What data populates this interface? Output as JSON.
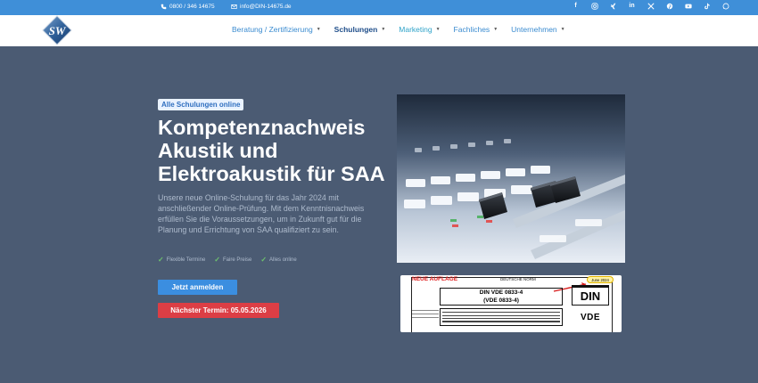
{
  "topbar": {
    "phone": "0800 / 346 14675",
    "email": "info@DIN-14675.de",
    "socials": [
      "facebook-icon",
      "instagram-icon",
      "xing-icon",
      "linkedin-icon",
      "x-icon",
      "pinterest-icon",
      "youtube-icon",
      "tiktok-icon",
      "whatsapp-icon"
    ],
    "color": "#3f8fd8"
  },
  "header": {
    "logo_text": "SW",
    "nav": [
      {
        "label": "Beratung / Zertifizierung"
      },
      {
        "label": "Schulungen"
      },
      {
        "label": "Marketing"
      },
      {
        "label": "Fachliches"
      },
      {
        "label": "Unternehmen"
      }
    ]
  },
  "hero": {
    "badge": "Alle Schulungen online",
    "title": "Kompetenznachweis Akustik und Elektroakustik für SAA",
    "lead": "Unsere neue Online-Schulung für das Jahr 2024 mit anschließender Online-Prüfung. Mit dem Kenntnisnachweis erfüllen Sie die Voraussetzungen, um in Zukunft gut für die Planung und Errichtung von SAA qualifiziert zu sein.",
    "features": [
      "Flexible Termine",
      "Faire Preise",
      "Alles online"
    ],
    "cta_label": "Jetzt anmelden",
    "date_label": "Nächster Termin: 05.05.2026",
    "bg_color": "#4b5b73",
    "cta_color": "#3b8ee0",
    "date_color": "#dc3e45"
  },
  "doc": {
    "neue": "NEUE AUFLAGE",
    "deutsche_norm": "DEUTSCHE NORM",
    "date": "June 2024",
    "std_line1": "DIN VDE 0833-4",
    "std_line2": "(VDE 0833-4)",
    "din": "DIN",
    "vde": "VDE"
  }
}
